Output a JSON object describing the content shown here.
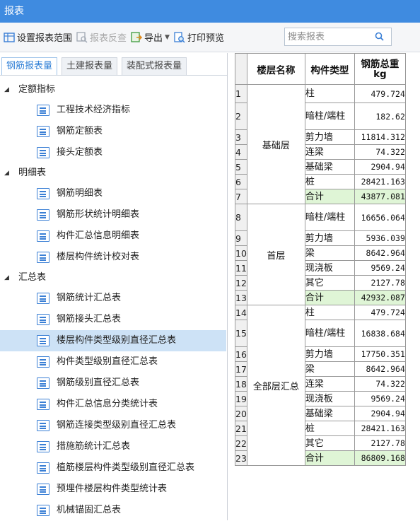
{
  "title": "报表",
  "toolbar": {
    "set_range": "设置报表范围",
    "reverse_check": "报表反查",
    "export": "导出",
    "print_preview": "打印预览",
    "search_placeholder": "搜索报表"
  },
  "tabs": [
    "钢筋报表量",
    "土建报表量",
    "装配式报表量"
  ],
  "tree": {
    "group_quota": "定额指标",
    "quota_items": [
      "工程技术经济指标",
      "钢筋定额表",
      "接头定额表"
    ],
    "group_detail": "明细表",
    "detail_items": [
      "钢筋明细表",
      "钢筋形状统计明细表",
      "构件汇总信息明细表",
      "楼层构件统计校对表"
    ],
    "group_summary": "汇总表",
    "summary_items": [
      "钢筋统计汇总表",
      "钢筋接头汇总表",
      "楼层构件类型级别直径汇总表",
      "构件类型级别直径汇总表",
      "钢筋级别直径汇总表",
      "构件汇总信息分类统计表",
      "钢筋连接类型级别直径汇总表",
      "措施筋统计汇总表",
      "植筋楼层构件类型级别直径汇总表",
      "预埋件楼层构件类型统计表",
      "机械锚固汇总表"
    ]
  },
  "grid": {
    "headers": {
      "floor": "楼层名称",
      "type": "构件类型",
      "weight": "钢筋总重",
      "unit": "kg"
    },
    "row_numbers": [
      "1",
      "2",
      "3",
      "4",
      "5",
      "6",
      "7",
      "8",
      "9",
      "10",
      "11",
      "12",
      "13",
      "14",
      "15",
      "16",
      "17",
      "18",
      "19",
      "20",
      "21",
      "22",
      "23"
    ],
    "floors": [
      "基础层",
      "首层",
      "全部层汇总"
    ],
    "types": [
      "柱",
      "暗柱/端柱",
      "剪力墙",
      "连梁",
      "基础梁",
      "桩",
      "合计",
      "暗柱/端柱",
      "剪力墙",
      "梁",
      "现浇板",
      "其它",
      "合计",
      "柱",
      "暗柱/端柱",
      "剪力墙",
      "梁",
      "连梁",
      "现浇板",
      "基础梁",
      "桩",
      "其它",
      "合计"
    ],
    "values": [
      "479.724",
      "182.62",
      "11814.312",
      "74.322",
      "2904.94",
      "28421.163",
      "43877.081",
      "16656.064",
      "5936.039",
      "8642.964",
      "9569.24",
      "2127.78",
      "42932.087",
      "479.724",
      "16838.684",
      "17750.351",
      "8642.964",
      "74.322",
      "9569.24",
      "2904.94",
      "28421.163",
      "2127.78",
      "86809.168"
    ]
  }
}
